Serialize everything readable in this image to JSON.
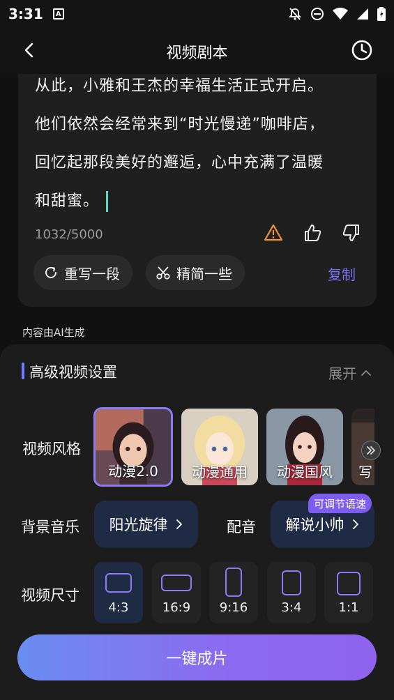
{
  "status_bar": {
    "time": "3:31",
    "notif_letter": "A"
  },
  "header": {
    "title": "视频剧本"
  },
  "script": {
    "lines": [
      "从此，小雅和王杰的幸福生活正式开启。",
      "他们依然会经常来到“时光慢递”咖啡店，",
      "回忆起那段美好的邂逅，心中充满了温暖",
      "和甜蜜。"
    ],
    "char_count": "1032/5000",
    "rewrite_label": "重写一段",
    "simplify_label": "精简一些",
    "copy_label": "复制"
  },
  "ai_note": "内容由AI生成",
  "settings": {
    "title": "高级视频设置",
    "expand_label": "展开",
    "style_label": "视频风格",
    "styles": [
      "动漫2.0",
      "动漫通用",
      "动漫国风",
      "写"
    ],
    "music_label": "背景音乐",
    "music_value": "阳光旋律",
    "voice_label": "配音",
    "voice_value": "解说小帅",
    "voice_tag": "可调节语速",
    "size_label": "视频尺寸",
    "sizes": [
      "4:3",
      "16:9",
      "9:16",
      "3:4",
      "1:1"
    ]
  },
  "generate_label": "一键成片",
  "colors": {
    "accent": "#8b7cf6",
    "link": "#7c72f0",
    "cursor": "#5fd6c4",
    "warning": "#f0903a"
  }
}
